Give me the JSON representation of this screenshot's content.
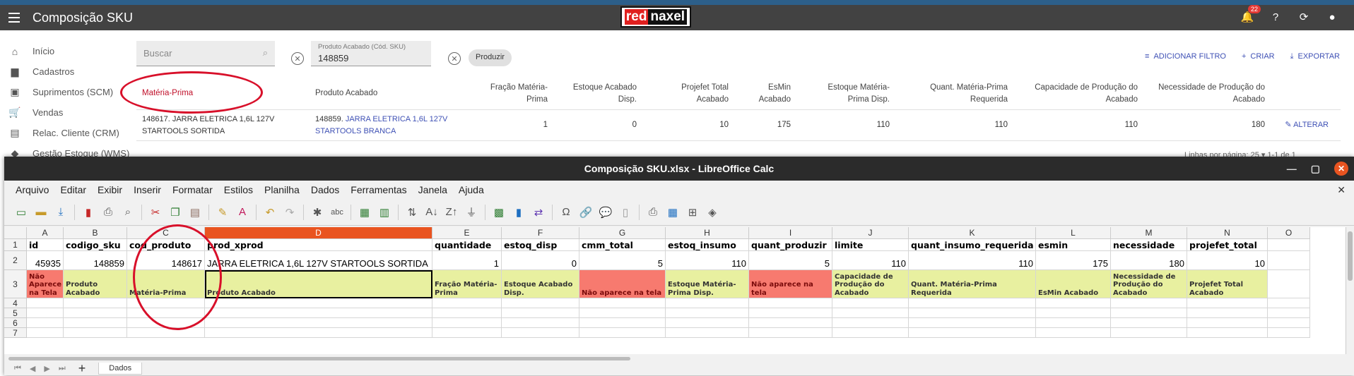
{
  "app": {
    "title": "Composição SKU",
    "logo": {
      "part1": "red",
      "part2": "naxel"
    },
    "notifications_count": "22"
  },
  "sidebar": {
    "items": [
      {
        "label": "Início",
        "icon": "home-icon"
      },
      {
        "label": "Cadastros",
        "icon": "folder-icon"
      },
      {
        "label": "Suprimentos (SCM)",
        "icon": "briefcase-icon"
      },
      {
        "label": "Vendas",
        "icon": "cart-icon"
      },
      {
        "label": "Relac. Cliente (CRM)",
        "icon": "contact-card-icon"
      },
      {
        "label": "Gestão Estoque (WMS)",
        "icon": "warehouse-icon"
      }
    ]
  },
  "filters": {
    "search_placeholder": "Buscar",
    "filter_label": "Produto Acabado (Cód. SKU)",
    "filter_value": "148859",
    "produzir_chip": "Produzir"
  },
  "actions": {
    "add_filter": "ADICIONAR FILTRO",
    "create": "CRIAR",
    "export": "EXPORTAR"
  },
  "table": {
    "headers": {
      "materia_prima": "Matéria-Prima",
      "produto_acabado": "Produto Acabado",
      "fracao": [
        "Fração Matéria-",
        "Prima"
      ],
      "estoque_acabado": [
        "Estoque Acabado",
        "Disp."
      ],
      "projefet": [
        "Projefet Total",
        "Acabado"
      ],
      "esmin": [
        "EsMin",
        "Acabado"
      ],
      "estoque_mp": [
        "Estoque Matéria-",
        "Prima Disp."
      ],
      "quant_mp": [
        "Quant. Matéria-Prima",
        "Requerida"
      ],
      "capacidade": [
        "Capacidade de Produção do",
        "Acabado"
      ],
      "necessidade": [
        "Necessidade de Produção do",
        "Acabado"
      ]
    },
    "row": {
      "materia_prima": [
        "148617. JARRA ELETRICA 1,6L 127V",
        "STARTOOLS SORTIDA"
      ],
      "produto_code": "148859.",
      "produto_link": [
        "JARRA ELETRICA 1,6L 127V",
        "STARTOOLS BRANCA"
      ],
      "fracao": "1",
      "estoque_acabado": "0",
      "projefet": "10",
      "esmin": "175",
      "estoque_mp": "110",
      "quant_mp": "110",
      "capacidade": "110",
      "necessidade": "180",
      "edit_label": "ALTERAR"
    },
    "pager": "Linhas por página:  25  ▾     1-1 de 1"
  },
  "calc": {
    "title": "Composição SKU.xlsx - LibreOffice Calc",
    "menu": [
      "Arquivo",
      "Editar",
      "Exibir",
      "Inserir",
      "Formatar",
      "Estilos",
      "Planilha",
      "Dados",
      "Ferramentas",
      "Janela",
      "Ajuda"
    ],
    "columns": [
      "A",
      "B",
      "C",
      "D",
      "E",
      "F",
      "G",
      "H",
      "I",
      "J",
      "K",
      "L",
      "M",
      "N",
      "O"
    ],
    "rows": [
      "1",
      "2",
      "3",
      "4",
      "5",
      "6",
      "7"
    ],
    "row1": [
      "id",
      "codigo_sku",
      "cod_produto",
      "prod_xprod",
      "quantidade",
      "estoq_disp",
      "cmm_total",
      "estoq_insumo",
      "quant_produzir",
      "limite",
      "quant_insumo_requerida",
      "esmin",
      "necessidade",
      "projefet_total"
    ],
    "row2": [
      "45935",
      "148859",
      "148617",
      "JARRA ELETRICA 1,6L 127V STARTOOLS SORTIDA",
      "1",
      "0",
      "5",
      "110",
      "5",
      "110",
      "110",
      "175",
      "180",
      "10"
    ],
    "row3": [
      "Não Aparece na Tela",
      "Produto Acabado",
      "Matéria-Prima",
      "Produto Acabado",
      "Fração Matéria-Prima",
      "Estoque Acabado Disp.",
      "Não aparece na tela",
      "Estoque Matéria-Prima Disp.",
      "Não aparece na tela",
      "Capacidade de Produção do Acabado",
      "Quant. Matéria-Prima Requerida",
      "EsMin Acabado",
      "Necessidade de Produção do Acabado",
      "Projefet Total Acabado"
    ],
    "sheet_tab": "Dados",
    "colors": {
      "yellow": "#e8f0a0",
      "red": "#f77a6f",
      "selected_col": "#e95420",
      "annotation": "#d8102a"
    }
  }
}
